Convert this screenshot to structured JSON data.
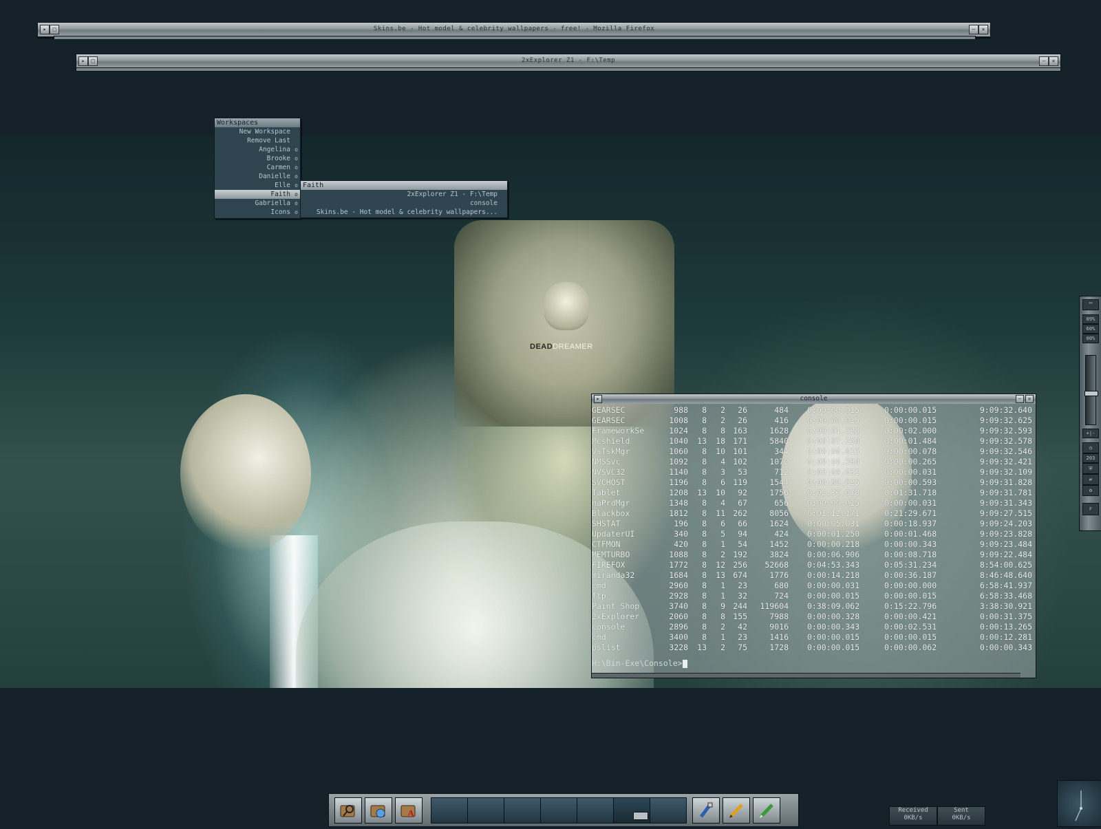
{
  "windows": {
    "firefox": {
      "title": "Skins.be - Hot model & celebrity wallpapers - free! - Mozilla Firefox"
    },
    "explorer": {
      "title": "2xExplorer Z1 - F:\\Temp"
    }
  },
  "wallpaper": {
    "logo_bold": "DEAD",
    "logo_light": "DREAMER"
  },
  "workspace_menu": {
    "header": "Workspaces",
    "commands": [
      "New Workspace",
      "Remove Last"
    ],
    "workspaces": [
      "Angelina",
      "Brooke",
      "Carmen",
      "Danielle",
      "Elle",
      "Faith",
      "Gabriella",
      "Icons"
    ],
    "active": "Faith",
    "submenu_marker": "o"
  },
  "faith_submenu": {
    "header": "Faith",
    "items": [
      "2xExplorer Z1 - F:\\Temp",
      "console",
      "Skins.be - Hot model & celebrity wallpapers..."
    ]
  },
  "console": {
    "title": "console",
    "rows": [
      [
        "GEARSEC",
        "988",
        "8",
        "2",
        "26",
        "484",
        "0:00:00.015",
        "0:00:00.015",
        "9:09:32.640"
      ],
      [
        "GEARSEC",
        "1008",
        "8",
        "2",
        "26",
        "416",
        "0:00:00.015",
        "0:00:00.015",
        "9:09:32.625"
      ],
      [
        "FrameworkSe",
        "1024",
        "8",
        "8",
        "163",
        "1628",
        "0:00:01.328",
        "0:00:02.000",
        "9:09:32.593"
      ],
      [
        "Mcshield",
        "1040",
        "13",
        "18",
        "171",
        "5840",
        "0:00:07.250",
        "0:00:01.484",
        "9:09:32.578"
      ],
      [
        "VsTskMgr",
        "1060",
        "8",
        "10",
        "101",
        "344",
        "0:00:00.015",
        "0:00:00.078",
        "9:09:32.546"
      ],
      [
        "NMSSvc",
        "1092",
        "8",
        "4",
        "102",
        "1072",
        "0:00:00.390",
        "0:00:00.265",
        "9:09:32.421"
      ],
      [
        "NVSVC32",
        "1140",
        "8",
        "3",
        "53",
        "712",
        "0:00:00.031",
        "0:00:00.031",
        "9:09:32.109"
      ],
      [
        "SVCHOST",
        "1196",
        "8",
        "6",
        "119",
        "1544",
        "0:00:00.625",
        "0:00:00.593",
        "9:09:31.828"
      ],
      [
        "Tablet",
        "1208",
        "13",
        "10",
        "92",
        "1756",
        "0:02:36.078",
        "0:01:31.718",
        "9:09:31.781"
      ],
      [
        "naPrdMgr",
        "1348",
        "8",
        "4",
        "67",
        "656",
        "0:00:00.015",
        "0:00:00.031",
        "9:09:31.343"
      ],
      [
        "Blackbox",
        "1812",
        "8",
        "11",
        "262",
        "8056",
        "0:01:12.171",
        "0:21:29.671",
        "9:09:27.515"
      ],
      [
        "SHSTAT",
        "196",
        "8",
        "6",
        "66",
        "1624",
        "0:00:05.031",
        "0:00:18.937",
        "9:09:24.203"
      ],
      [
        "UpdaterUI",
        "340",
        "8",
        "5",
        "94",
        "424",
        "0:00:01.250",
        "0:00:01.468",
        "9:09:23.828"
      ],
      [
        "CTFMON",
        "420",
        "8",
        "1",
        "54",
        "1452",
        "0:00:00.218",
        "0:00:00.343",
        "9:09:23.484"
      ],
      [
        "MEMTURBO",
        "1088",
        "8",
        "2",
        "192",
        "3824",
        "0:00:06.906",
        "0:00:08.718",
        "9:09:22.484"
      ],
      [
        "FIREFOX",
        "1772",
        "8",
        "12",
        "256",
        "52668",
        "0:04:53.343",
        "0:05:31.234",
        "8:54:00.625"
      ],
      [
        "miranda32",
        "1684",
        "8",
        "13",
        "674",
        "1776",
        "0:00:14.218",
        "0:00:36.187",
        "8:46:48.640"
      ],
      [
        "cmd",
        "2960",
        "8",
        "1",
        "23",
        "680",
        "0:00:00.031",
        "0:00:00.000",
        "6:58:41.937"
      ],
      [
        "ftp",
        "2928",
        "8",
        "1",
        "32",
        "724",
        "0:00:00.015",
        "0:00:00.015",
        "6:58:33.468"
      ],
      [
        "Paint Shop",
        "3740",
        "8",
        "9",
        "244",
        "119604",
        "0:38:09.062",
        "0:15:22.796",
        "3:38:30.921"
      ],
      [
        "2xExplorer",
        "2060",
        "8",
        "8",
        "155",
        "7988",
        "0:00:00.328",
        "0:00:00.421",
        "0:00:31.375"
      ],
      [
        "console",
        "2896",
        "8",
        "2",
        "42",
        "9016",
        "0:00:00.343",
        "0:00:02.531",
        "0:00:13.265"
      ],
      [
        "cmd",
        "3400",
        "8",
        "1",
        "23",
        "1416",
        "0:00:00.015",
        "0:00:00.015",
        "0:00:12.281"
      ],
      [
        "pslist",
        "3228",
        "13",
        "2",
        "75",
        "1728",
        "0:00:00.015",
        "0:00:00.062",
        "0:00:00.343"
      ]
    ],
    "prompt": "H:\\Bin-Exe\\Console>"
  },
  "side_panel": {
    "cpu": "09%",
    "mem": "60%",
    "swap": "00%",
    "plus_minus": "+|-",
    "day": "203",
    "workspace_letter": "F",
    "volume_fraction": 0.45
  },
  "taskbar": {
    "launchers": [
      "search-folder-icon",
      "network-folder-icon",
      "fonts-folder-icon"
    ],
    "pager_slots": 7,
    "active_slot": 5,
    "tools": [
      "paint-brush-icon",
      "pencil-icon",
      "green-pen-icon"
    ]
  },
  "net": {
    "received_label": "Received",
    "received_value": "0KB/s",
    "sent_label": "Sent",
    "sent_value": "0KB/s"
  },
  "colors": {
    "desktop": "#142128",
    "menu": "#2e4550",
    "chrome": "#8f989d"
  }
}
